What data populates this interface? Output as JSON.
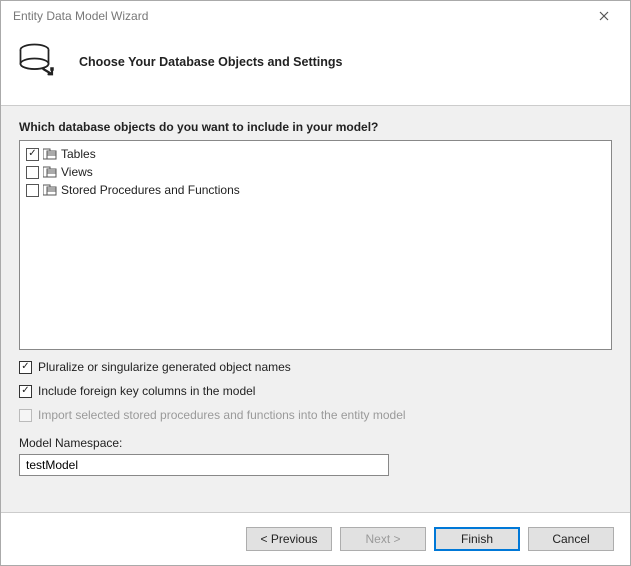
{
  "window": {
    "title": "Entity Data Model Wizard"
  },
  "header": {
    "title": "Choose Your Database Objects and Settings"
  },
  "body": {
    "question": "Which database objects do you want to include in your model?",
    "tree": [
      {
        "label": "Tables",
        "checked": true
      },
      {
        "label": "Views",
        "checked": false
      },
      {
        "label": "Stored Procedures and Functions",
        "checked": false
      }
    ],
    "options": {
      "pluralize": {
        "label": "Pluralize or singularize generated object names",
        "checked": true,
        "enabled": true
      },
      "foreign_keys": {
        "label": "Include foreign key columns in the model",
        "checked": true,
        "enabled": true
      },
      "import_sprocs": {
        "label": "Import selected stored procedures and functions into the entity model",
        "checked": false,
        "enabled": false
      }
    },
    "namespace_label": "Model Namespace:",
    "namespace_value": "testModel"
  },
  "footer": {
    "previous": "< Previous",
    "next": "Next >",
    "finish": "Finish",
    "cancel": "Cancel"
  }
}
